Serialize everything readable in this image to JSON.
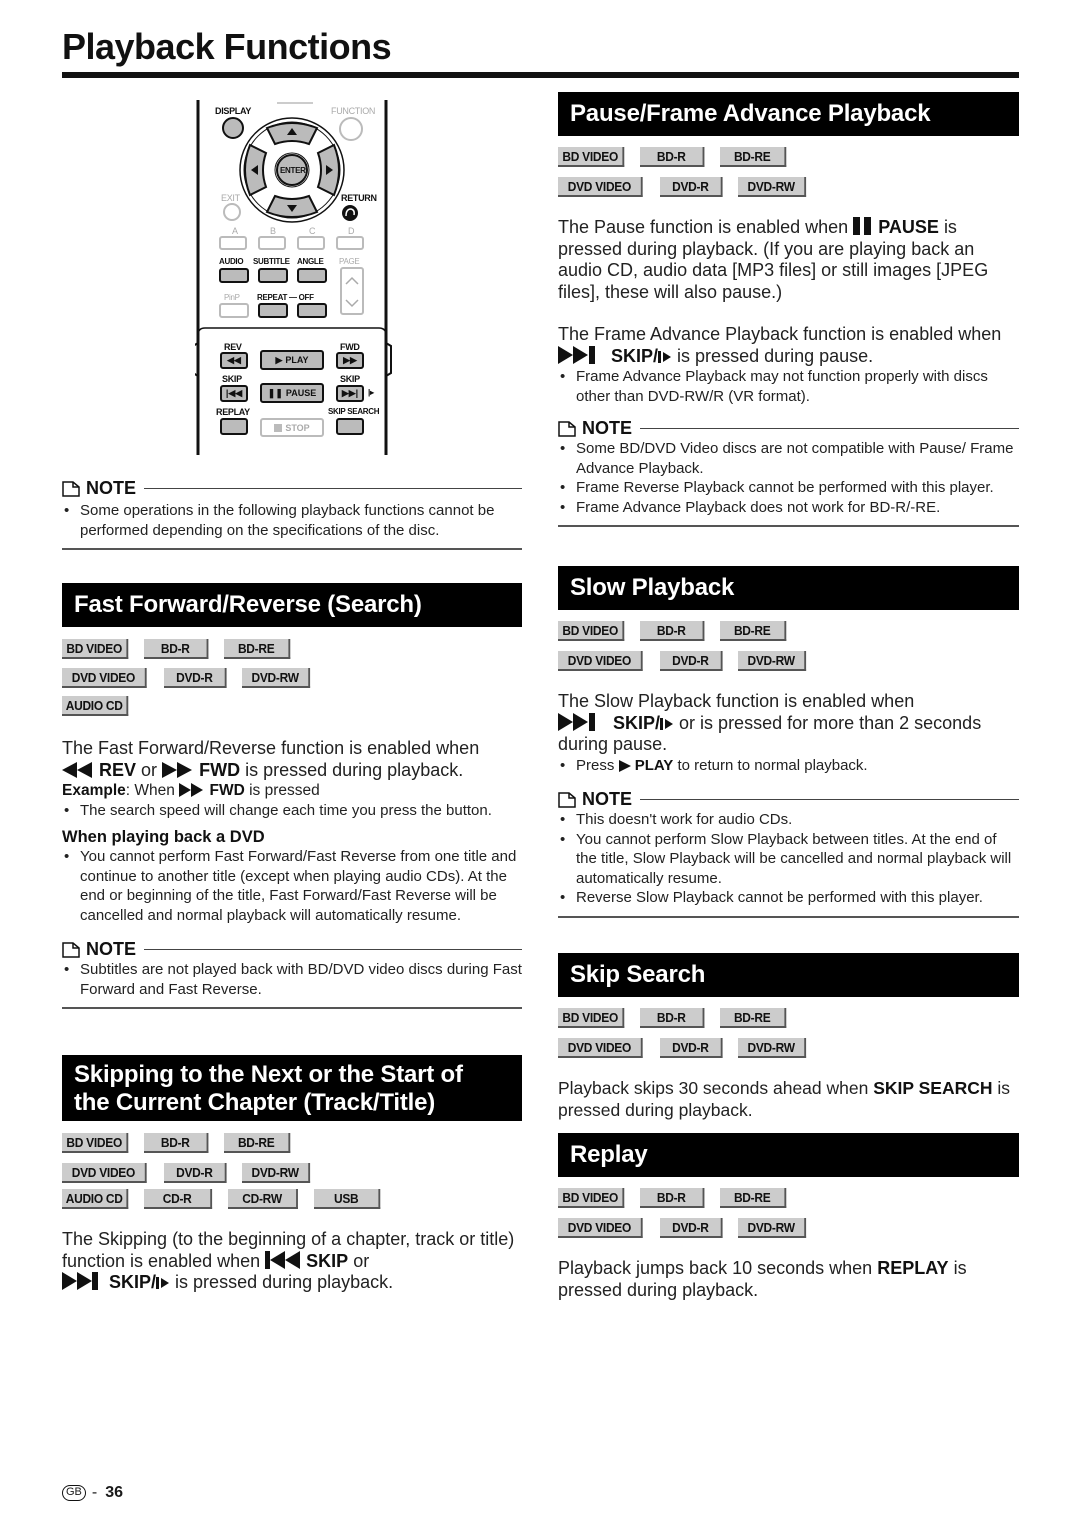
{
  "page": {
    "title": "Playback Functions",
    "page_region": "GB",
    "page_separator": "-",
    "page_number": "36"
  },
  "remote": {
    "labels": {
      "display": "DISPLAY",
      "function": "FUNCTION",
      "enter": "ENTER",
      "exit": "EXIT",
      "return": "RETURN",
      "a": "A",
      "b": "B",
      "c": "C",
      "d": "D",
      "audio": "AUDIO",
      "subtitle": "SUBTITLE",
      "angle": "ANGLE",
      "page": "PAGE",
      "pinp": "PinP",
      "repeat_off": "REPEAT — OFF",
      "rev": "REV",
      "fwd": "FWD",
      "play": "PLAY",
      "skip_prev": "SKIP",
      "skip_next": "SKIP",
      "pause": "PAUSE",
      "replay": "REPLAY",
      "skip_search": "SKIP SEARCH",
      "stop": "STOP"
    }
  },
  "intro_note": {
    "label": "NOTE",
    "items": [
      "Some operations in the following playback functions cannot be performed depending on the specifications of the disc."
    ]
  },
  "sections": {
    "fast_forward": {
      "title": "Fast Forward/Reverse (Search)",
      "badges": [
        [
          "BD VIDEO",
          "BD-R",
          "BD-RE"
        ],
        [
          "DVD VIDEO",
          "DVD-R",
          "DVD-RW"
        ],
        [
          "AUDIO CD"
        ]
      ],
      "text_a": "The Fast Forward/Reverse function is enabled when",
      "rev": "REV",
      "or": "or",
      "fwd": "FWD",
      "text_b": "is pressed during playback.",
      "example_label": "Example",
      "example_text": ": When",
      "example_fwd": "FWD",
      "example_end": "is pressed",
      "bullets": [
        "The search speed will change each time you press the button."
      ],
      "subhead": "When playing back a DVD",
      "dvd_bullets": [
        "You cannot perform Fast Forward/Fast Reverse from one title and continue to another title (except when playing audio CDs). At the end or beginning of the title, Fast Forward/Fast Reverse will be cancelled and normal playback will automatically resume."
      ],
      "note_label": "NOTE",
      "note_items": [
        "Subtitles are not played back with BD/DVD video discs during Fast Forward and Fast Reverse."
      ]
    },
    "skipping": {
      "title_line1": "Skipping to the Next or the Start of",
      "title_line2": "the Current Chapter (Track/Title)",
      "badges": [
        [
          "BD VIDEO",
          "BD-R",
          "BD-RE"
        ],
        [
          "DVD VIDEO",
          "DVD-R",
          "DVD-RW"
        ],
        [
          "AUDIO CD",
          "CD-R",
          "CD-RW",
          "USB"
        ]
      ],
      "text_a": "The Skipping (to the beginning of a chapter, track or title) function is enabled when",
      "skip": "SKIP",
      "or": "or",
      "skip_next": "SKIP/",
      "text_b": "is pressed during playback."
    },
    "pause": {
      "title": "Pause/Frame Advance Playback",
      "badges": [
        [
          "BD VIDEO",
          "BD-R",
          "BD-RE"
        ],
        [
          "DVD VIDEO",
          "DVD-R",
          "DVD-RW"
        ]
      ],
      "text_a": "The Pause function is enabled when",
      "pause": "PAUSE",
      "text_b": "is pressed during playback. (If you are playing back an audio CD, audio data [MP3 files] or still images [JPEG files], these will also pause.)",
      "frame_text_a": "The Frame Advance Playback function is enabled when",
      "frame_skip": "SKIP/",
      "frame_text_b": "is pressed during pause.",
      "bullets": [
        "Frame Advance Playback may not function properly with discs other than DVD-RW/R (VR format)."
      ],
      "note_label": "NOTE",
      "note_items": [
        "Some BD/DVD Video discs are not compatible with Pause/ Frame Advance Playback.",
        "Frame Reverse Playback cannot be performed with this player.",
        "Frame Advance Playback does not work for BD-R/-RE."
      ]
    },
    "slow": {
      "title": "Slow Playback",
      "badges": [
        [
          "BD VIDEO",
          "BD-R",
          "BD-RE"
        ],
        [
          "DVD VIDEO",
          "DVD-R",
          "DVD-RW"
        ]
      ],
      "text_a": "The Slow Playback function is enabled when",
      "skip": "SKIP/",
      "text_b": "or is pressed for more than 2 seconds during pause.",
      "bullet_a": "Press",
      "bullet_play": "PLAY",
      "bullet_b": "to return to normal playback.",
      "note_label": "NOTE",
      "note_items": [
        "This doesn't work for audio CDs.",
        "You cannot perform Slow Playback between titles. At the end of the title, Slow Playback will be cancelled and normal playback will automatically resume.",
        "Reverse Slow Playback cannot be performed with this player."
      ]
    },
    "skip_search": {
      "title": "Skip Search",
      "badges": [
        [
          "BD VIDEO",
          "BD-R",
          "BD-RE"
        ],
        [
          "DVD VIDEO",
          "DVD-R",
          "DVD-RW"
        ]
      ],
      "text_a": "Playback skips 30 seconds ahead when",
      "key": "SKIP SEARCH",
      "text_b": "is pressed during playback."
    },
    "replay": {
      "title": "Replay",
      "badges": [
        [
          "BD VIDEO",
          "BD-R",
          "BD-RE"
        ],
        [
          "DVD VIDEO",
          "DVD-R",
          "DVD-RW"
        ]
      ],
      "text_a": "Playback jumps back 10 seconds when",
      "key": "REPLAY",
      "text_b": "is pressed during playback."
    }
  }
}
